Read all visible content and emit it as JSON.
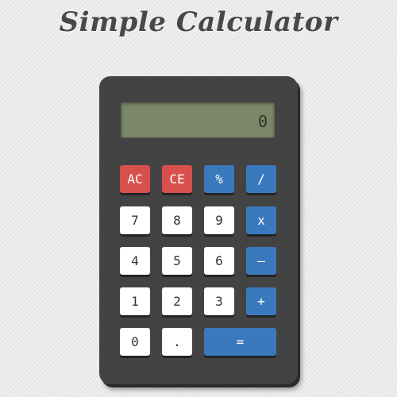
{
  "app": {
    "title": "Simple Calculator"
  },
  "display": {
    "value": "0"
  },
  "keys": {
    "ac": "AC",
    "ce": "CE",
    "percent": "%",
    "divide": "/",
    "seven": "7",
    "eight": "8",
    "nine": "9",
    "multiply": "x",
    "four": "4",
    "five": "5",
    "six": "6",
    "subtract": "–",
    "one": "1",
    "two": "2",
    "three": "3",
    "add": "+",
    "zero": "0",
    "decimal": ".",
    "equals": "="
  },
  "colors": {
    "clear_keys": "#d8504d",
    "operator_keys": "#3b79bd",
    "digit_keys": "#ffffff",
    "body": "#434343",
    "display": "#7b8768"
  }
}
